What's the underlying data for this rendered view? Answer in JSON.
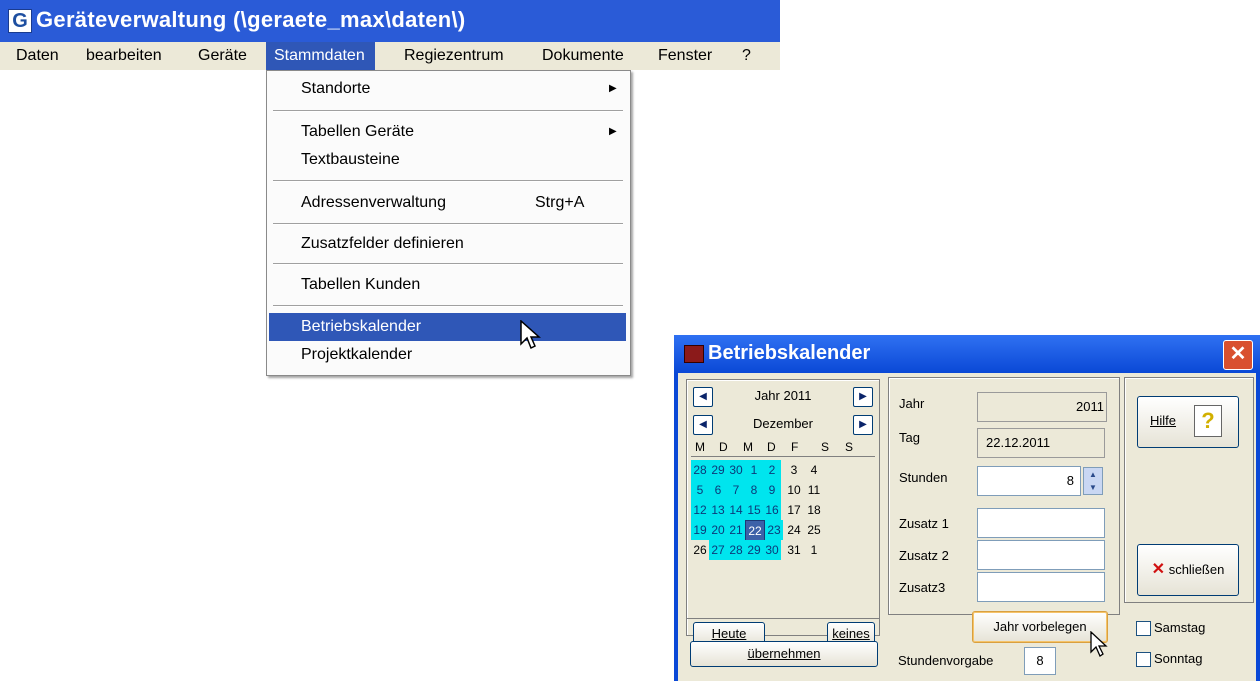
{
  "main_window": {
    "app_icon_letter": "G",
    "title": "Geräteverwaltung (\\geraete_max\\daten\\)"
  },
  "menubar": {
    "items": [
      "Daten",
      "bearbeiten",
      "Geräte",
      "Stammdaten",
      "Regiezentrum",
      "Dokumente",
      "Fenster",
      "?"
    ],
    "active": "Stammdaten"
  },
  "stammdaten_menu": {
    "items": [
      {
        "label": "Standorte",
        "submenu": true
      },
      {
        "label": "Tabellen Geräte",
        "submenu": true
      },
      {
        "label": "Textbausteine"
      },
      {
        "label": "Adressenverwaltung",
        "shortcut": "Strg+A"
      },
      {
        "label": "Zusatzfelder definieren"
      },
      {
        "label": "Tabellen Kunden"
      },
      {
        "label": "Betriebskalender",
        "highlighted": true
      },
      {
        "label": "Projektkalender"
      }
    ]
  },
  "dialog": {
    "title": "Betriebskalender",
    "close_glyph": "✕",
    "calendar": {
      "year_label": "Jahr 2011",
      "month_label": "Dezember",
      "weekday_headers": [
        "M",
        "D",
        "M",
        "D",
        "F",
        "S",
        "S"
      ],
      "weeks": [
        [
          "28",
          "29",
          "30",
          "1",
          "2",
          "3",
          "4"
        ],
        [
          "5",
          "6",
          "7",
          "8",
          "9",
          "10",
          "11"
        ],
        [
          "12",
          "13",
          "14",
          "15",
          "16",
          "17",
          "18"
        ],
        [
          "19",
          "20",
          "21",
          "22",
          "23",
          "24",
          "25"
        ],
        [
          "26",
          "27",
          "28",
          "29",
          "30",
          "31",
          "1"
        ]
      ],
      "selected_day": "22",
      "heute_button": "Heute",
      "keines_button": "keines",
      "uebernehmen_button": "übernehmen"
    },
    "fields": {
      "jahr_label": "Jahr",
      "jahr_value": "2011",
      "tag_label": "Tag",
      "tag_value": "22.12.2011",
      "stunden_label": "Stunden",
      "stunden_value": "8",
      "zusatz1_label": "Zusatz 1",
      "zusatz1_value": "",
      "zusatz2_label": "Zusatz 2",
      "zusatz2_value": "",
      "zusatz3_label": "Zusatz3",
      "zusatz3_value": ""
    },
    "hilfe_button": "Hilfe",
    "schliessen_button": "schließen",
    "jahr_vorbelegen_button": "Jahr vorbelegen",
    "stundenvorgabe_label": "Stundenvorgabe",
    "stundenvorgabe_value": "8",
    "samstag_label": "Samstag",
    "sonntag_label": "Sonntag",
    "samstag_checked": false,
    "sonntag_checked": false
  },
  "colors": {
    "titlebar": "#2a5bd7",
    "menu_highlight": "#2f57b7",
    "workday": "#00e5ee",
    "selected_day": "#3c61a8",
    "dialog_frame": "#0a48d6",
    "close_button": "#d9502f"
  },
  "icons": {
    "app": "app-g-icon",
    "submenu": "chevron-right-icon",
    "cursor": "mouse-pointer-icon",
    "dialog": "calendar-app-icon",
    "close": "close-icon",
    "nav_prev": "arrow-left-icon",
    "nav_next": "arrow-right-icon",
    "spin": "spin-updown-icon",
    "help": "help-question-icon",
    "close_x": "red-x-icon"
  }
}
